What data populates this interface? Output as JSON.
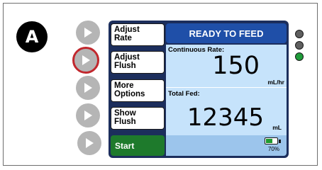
{
  "panel_label": "A",
  "menu": {
    "adjust_rate": [
      "Adjust",
      "Rate"
    ],
    "adjust_flush": [
      "Adjust",
      "Flush"
    ],
    "more_options": [
      "More",
      "Options"
    ],
    "show_flush": [
      "Show",
      "Flush"
    ],
    "start": "Start"
  },
  "status": "READY TO FEED",
  "continuous_rate": {
    "label": "Continuous Rate:",
    "value": "150",
    "unit": "mL/hr"
  },
  "total_fed": {
    "label": "Total Fed:",
    "value": "12345",
    "unit": "mL"
  },
  "battery": {
    "percent_text": "70%",
    "level": 0.7,
    "color": "#1e9a2e"
  },
  "indicator_lights": [
    {
      "name": "grey",
      "color": "#5f5f5f"
    },
    {
      "name": "grey",
      "color": "#5f5f5f"
    },
    {
      "name": "green",
      "color": "#1f9c3a"
    }
  ],
  "colors": {
    "selected_ring": "#c1272d",
    "status_banner": "#1f4fa8",
    "start_button": "#1e7a2c",
    "info_panel": "#c6e3fb"
  },
  "icons": {
    "side_buttons": "play-icon",
    "battery": "battery-icon"
  }
}
